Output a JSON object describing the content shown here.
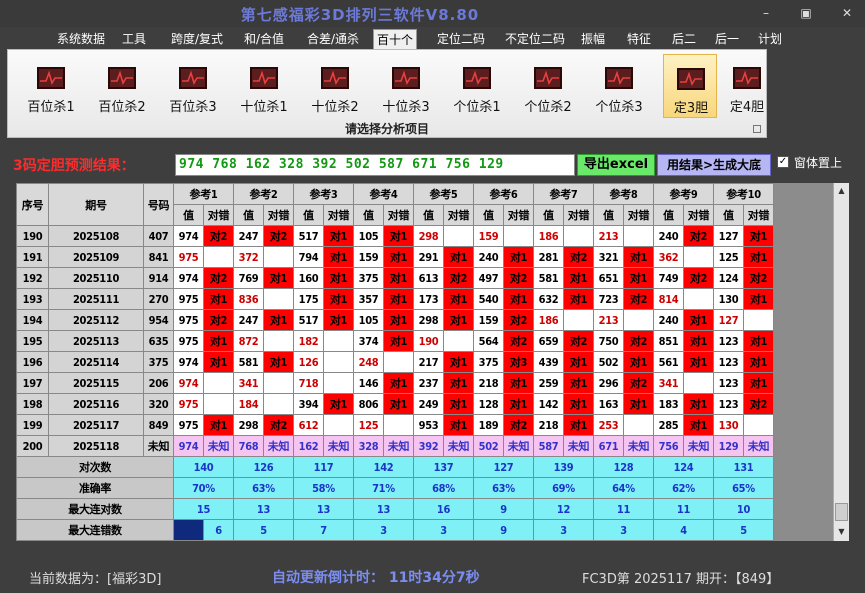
{
  "window": {
    "title": "第七感福彩3D排列三软件V8.80",
    "min": "–",
    "max": "▣",
    "close": "✕"
  },
  "menu": [
    "系统数据",
    "工具",
    "跨度/复式",
    "和/合值",
    "合差/通杀",
    "百十个",
    "定位二码",
    "不定位二码",
    "振幅",
    "特征",
    "后二",
    "后一",
    "计划"
  ],
  "menu_active": "百十个",
  "ribbon": {
    "buttons": [
      "百位杀1",
      "百位杀2",
      "百位杀3",
      "十位杀1",
      "十位杀2",
      "十位杀3",
      "个位杀1",
      "个位杀2",
      "个位杀3",
      "定3胆",
      "定4胆"
    ],
    "selected": "定3胆",
    "caption": "请选择分析项目"
  },
  "result": {
    "label": "3码定胆预测结果：",
    "value": "974 768 162 328 392 502 587 671 756 129",
    "btn_excel": "导出excel",
    "btn_big": "用结果>生成大底",
    "checkbox_label": "窗体置上",
    "checkbox_checked": true
  },
  "table": {
    "head": {
      "seq": "序号",
      "period": "期号",
      "code": "号码",
      "val": "值",
      "ok": "对错"
    },
    "refs": [
      "参考1",
      "参考2",
      "参考3",
      "参考4",
      "参考5",
      "参考6",
      "参考7",
      "参考8",
      "参考9",
      "参考10"
    ],
    "rows": [
      {
        "seq": "190",
        "period": "2025108",
        "code": "407",
        "cells": [
          [
            "974",
            "对2",
            1
          ],
          [
            "247",
            "对2",
            1
          ],
          [
            "517",
            "对1",
            1
          ],
          [
            "105",
            "对1",
            1
          ],
          [
            "298",
            "",
            0
          ],
          [
            "159",
            "",
            0
          ],
          [
            "186",
            "",
            0
          ],
          [
            "213",
            "",
            0
          ],
          [
            "240",
            "对2",
            1
          ],
          [
            "127",
            "对1",
            1
          ]
        ]
      },
      {
        "seq": "191",
        "period": "2025109",
        "code": "841",
        "cells": [
          [
            "975",
            "",
            0
          ],
          [
            "372",
            "",
            0
          ],
          [
            "794",
            "对1",
            1
          ],
          [
            "159",
            "对1",
            1
          ],
          [
            "291",
            "对1",
            1
          ],
          [
            "240",
            "对1",
            1
          ],
          [
            "281",
            "对2",
            1
          ],
          [
            "321",
            "对1",
            1
          ],
          [
            "362",
            "",
            0
          ],
          [
            "125",
            "对1",
            1
          ]
        ]
      },
      {
        "seq": "192",
        "period": "2025110",
        "code": "914",
        "cells": [
          [
            "974",
            "对2",
            1
          ],
          [
            "769",
            "对1",
            1
          ],
          [
            "160",
            "对1",
            1
          ],
          [
            "375",
            "对1",
            1
          ],
          [
            "613",
            "对2",
            1
          ],
          [
            "497",
            "对2",
            1
          ],
          [
            "581",
            "对1",
            1
          ],
          [
            "651",
            "对1",
            1
          ],
          [
            "749",
            "对2",
            1
          ],
          [
            "124",
            "对2",
            1
          ]
        ]
      },
      {
        "seq": "193",
        "period": "2025111",
        "code": "270",
        "cells": [
          [
            "975",
            "对1",
            1
          ],
          [
            "836",
            "",
            0
          ],
          [
            "175",
            "对1",
            1
          ],
          [
            "357",
            "对1",
            1
          ],
          [
            "173",
            "对1",
            1
          ],
          [
            "540",
            "对1",
            1
          ],
          [
            "632",
            "对1",
            1
          ],
          [
            "723",
            "对2",
            1
          ],
          [
            "814",
            "",
            0
          ],
          [
            "130",
            "对1",
            1
          ]
        ]
      },
      {
        "seq": "194",
        "period": "2025112",
        "code": "954",
        "cells": [
          [
            "975",
            "对2",
            1
          ],
          [
            "247",
            "对1",
            1
          ],
          [
            "517",
            "对1",
            1
          ],
          [
            "105",
            "对1",
            1
          ],
          [
            "298",
            "对1",
            1
          ],
          [
            "159",
            "对2",
            1
          ],
          [
            "186",
            "",
            0
          ],
          [
            "213",
            "",
            0
          ],
          [
            "240",
            "对1",
            1
          ],
          [
            "127",
            "",
            0
          ]
        ]
      },
      {
        "seq": "195",
        "period": "2025113",
        "code": "635",
        "cells": [
          [
            "975",
            "对1",
            1
          ],
          [
            "872",
            "",
            0
          ],
          [
            "182",
            "",
            0
          ],
          [
            "374",
            "对1",
            1
          ],
          [
            "190",
            "",
            0
          ],
          [
            "564",
            "对2",
            1
          ],
          [
            "659",
            "对2",
            1
          ],
          [
            "750",
            "对2",
            1
          ],
          [
            "851",
            "对1",
            1
          ],
          [
            "123",
            "对1",
            1
          ]
        ]
      },
      {
        "seq": "196",
        "period": "2025114",
        "code": "375",
        "cells": [
          [
            "974",
            "对1",
            1
          ],
          [
            "581",
            "对1",
            1
          ],
          [
            "126",
            "",
            0
          ],
          [
            "248",
            "",
            0
          ],
          [
            "217",
            "对1",
            1
          ],
          [
            "375",
            "对3",
            1
          ],
          [
            "439",
            "对1",
            1
          ],
          [
            "502",
            "对1",
            1
          ],
          [
            "561",
            "对1",
            1
          ],
          [
            "123",
            "对1",
            1
          ]
        ]
      },
      {
        "seq": "197",
        "period": "2025115",
        "code": "206",
        "cells": [
          [
            "974",
            "",
            0
          ],
          [
            "341",
            "",
            0
          ],
          [
            "718",
            "",
            0
          ],
          [
            "146",
            "对1",
            1
          ],
          [
            "237",
            "对1",
            1
          ],
          [
            "218",
            "对1",
            1
          ],
          [
            "259",
            "对1",
            1
          ],
          [
            "296",
            "对2",
            1
          ],
          [
            "341",
            "",
            0
          ],
          [
            "123",
            "对1",
            1
          ]
        ]
      },
      {
        "seq": "198",
        "period": "2025116",
        "code": "320",
        "cells": [
          [
            "975",
            "",
            0
          ],
          [
            "184",
            "",
            0
          ],
          [
            "394",
            "对1",
            1
          ],
          [
            "806",
            "对1",
            1
          ],
          [
            "249",
            "对1",
            1
          ],
          [
            "128",
            "对1",
            1
          ],
          [
            "142",
            "对1",
            1
          ],
          [
            "163",
            "对1",
            1
          ],
          [
            "183",
            "对1",
            1
          ],
          [
            "123",
            "对2",
            1
          ]
        ]
      },
      {
        "seq": "199",
        "period": "2025117",
        "code": "849",
        "cells": [
          [
            "975",
            "对1",
            1
          ],
          [
            "298",
            "对2",
            1
          ],
          [
            "612",
            "",
            0
          ],
          [
            "125",
            "",
            0
          ],
          [
            "953",
            "对1",
            1
          ],
          [
            "189",
            "对2",
            1
          ],
          [
            "218",
            "对1",
            1
          ],
          [
            "253",
            "",
            0
          ],
          [
            "285",
            "对1",
            1
          ],
          [
            "130",
            "",
            0
          ]
        ]
      },
      {
        "seq": "200",
        "period": "2025118",
        "code": "未知",
        "cells": [
          [
            "974",
            "未知",
            2
          ],
          [
            "768",
            "未知",
            2
          ],
          [
            "162",
            "未知",
            2
          ],
          [
            "328",
            "未知",
            2
          ],
          [
            "392",
            "未知",
            2
          ],
          [
            "502",
            "未知",
            2
          ],
          [
            "587",
            "未知",
            2
          ],
          [
            "671",
            "未知",
            2
          ],
          [
            "756",
            "未知",
            2
          ],
          [
            "129",
            "未知",
            2
          ]
        ]
      }
    ],
    "summary": [
      {
        "label": "对次数",
        "values": [
          "140",
          "126",
          "117",
          "142",
          "137",
          "127",
          "139",
          "128",
          "124",
          "131"
        ]
      },
      {
        "label": "准确率",
        "values": [
          "70%",
          "63%",
          "58%",
          "71%",
          "68%",
          "63%",
          "69%",
          "64%",
          "62%",
          "65%"
        ]
      },
      {
        "label": "最大连对数",
        "values": [
          "15",
          "13",
          "13",
          "13",
          "16",
          "9",
          "12",
          "11",
          "11",
          "10"
        ]
      },
      {
        "label": "最大连错数",
        "values": [
          "6",
          "5",
          "7",
          "3",
          "3",
          "9",
          "3",
          "3",
          "4",
          "5"
        ]
      }
    ]
  },
  "status": {
    "current": "当前数据为：[福彩3D]",
    "countdown": "自动更新倒计时：  11时34分7秒",
    "info": "FC3D第 2025117 期开：【849】"
  },
  "colors": {
    "hit": "#ff0000",
    "miss_value": "#cc0000",
    "pending_row": "#f6c4f0",
    "summary_cell": "#7ff0f5",
    "accent_title": "#6b79d8",
    "predict_label": "#ff2b2b",
    "predict_text": "#119911"
  }
}
